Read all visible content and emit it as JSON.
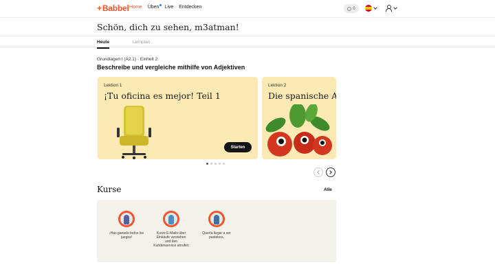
{
  "nav": {
    "logo": "Babbel",
    "links": [
      {
        "label": "Home",
        "active": true
      },
      {
        "label": "Üben",
        "active": false
      },
      {
        "label": "Live",
        "active": false
      },
      {
        "label": "Entdecken",
        "active": false
      }
    ],
    "streak_count": "0",
    "accent_color": "#f2542d",
    "language_flag": "spain-flag-icon",
    "user_menu_icon": "user-icon"
  },
  "greeting": "Schön, dich zu sehen, m3atman!",
  "tabs": [
    {
      "label": "Heute",
      "active": true
    },
    {
      "label": "Lernplan",
      "active": false
    }
  ],
  "unit": {
    "subtitle": "Grundlagen I (A2.1) · Einheit 2",
    "title": "Beschreibe und vergleiche mithilfe von Adjektiven"
  },
  "lessons": [
    {
      "label": "Lektion 1",
      "title": "¡Tu oficina es mejor! Teil 1",
      "button": "Starten",
      "image": "office-chair-illustration"
    },
    {
      "label": "Lektion 2",
      "title": "Die spanische Auss",
      "image": "guarana-fruit-illustration"
    }
  ],
  "carousel": {
    "pages": 5,
    "current": 1
  },
  "courses_section": {
    "title": "Kurse",
    "see_all": "Alle",
    "items": [
      {
        "name": "¡Has ganado todos los juegos!",
        "avatar_color": "#5a5f9e"
      },
      {
        "name": "Kurze E-Mails über Einkäufe verstehen und den Kundenservice anrufen",
        "avatar_color": "#4f8fbf"
      },
      {
        "name": "Quería llegar a ser pastelera.",
        "avatar_color": "#3e6fa6"
      }
    ]
  }
}
